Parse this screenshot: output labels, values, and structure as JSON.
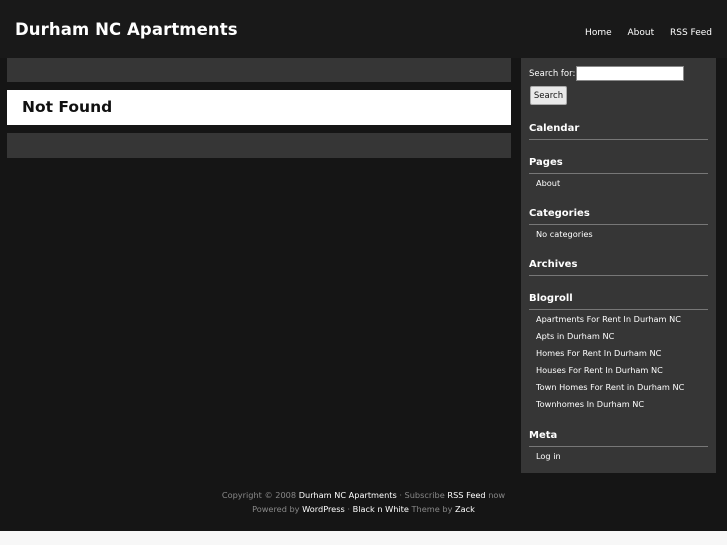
{
  "site": {
    "title": "Durham NC Apartments"
  },
  "nav": {
    "items": [
      "Home",
      "About",
      "RSS Feed"
    ]
  },
  "main": {
    "not_found": "Not Found"
  },
  "sidebar": {
    "search": {
      "label": "Search for:",
      "value": "",
      "button": "Search"
    },
    "calendar": {
      "heading": "Calendar"
    },
    "pages": {
      "heading": "Pages",
      "items": [
        "About"
      ]
    },
    "categories": {
      "heading": "Categories",
      "items": [
        "No categories"
      ]
    },
    "archives": {
      "heading": "Archives"
    },
    "blogroll": {
      "heading": "Blogroll",
      "items": [
        "Apartments For Rent In Durham NC",
        "Apts in Durham NC",
        "Homes For Rent In Durham NC",
        "Houses For Rent In Durham NC",
        "Town Homes For Rent in Durham NC",
        "Townhomes In Durham NC"
      ]
    },
    "meta": {
      "heading": "Meta",
      "items": [
        "Log in"
      ]
    }
  },
  "footer": {
    "copyright": "Copyright © 2008",
    "site_link": "Durham NC Apartments",
    "subscribe": "· Subscribe",
    "rss_link": "RSS Feed",
    "now": "now",
    "powered_by": "Powered by",
    "wordpress": "WordPress",
    "sep": "·",
    "theme": "Black n White",
    "theme_by": "Theme by",
    "author": "Zack"
  }
}
